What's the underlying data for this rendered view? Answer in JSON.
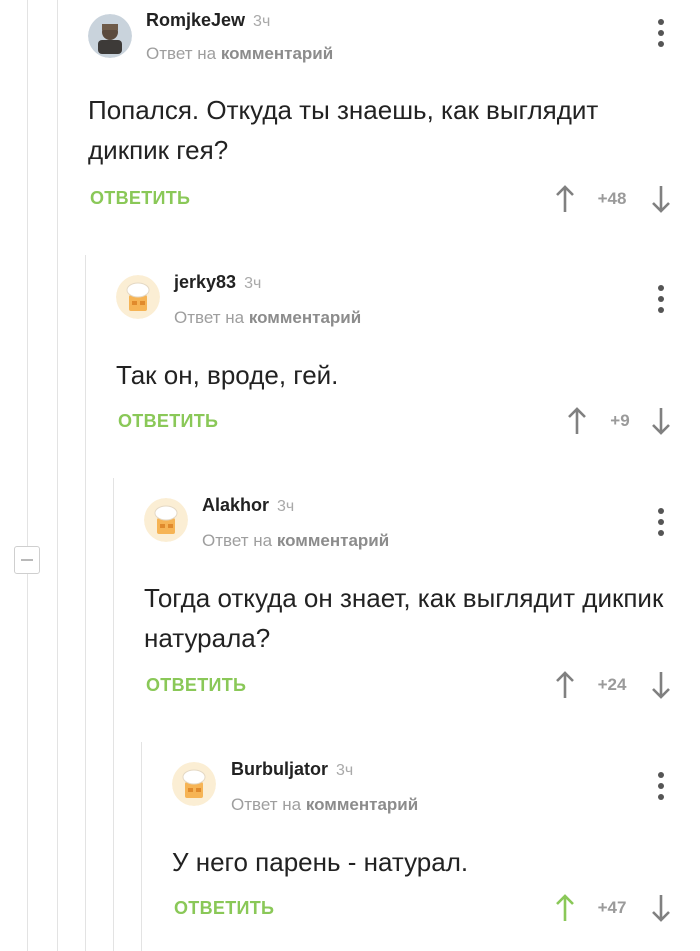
{
  "comments": [
    {
      "user": "RomjkeJew",
      "time": "3ч",
      "reply_prefix": "Ответ на",
      "reply_target": "комментарий",
      "text": "Попался. Откуда ты знаешь, как выглядит дикпик гея?",
      "reply_label": "ОТВЕТИТЬ",
      "score": "+48",
      "upvoted": false
    },
    {
      "user": "jerky83",
      "time": "3ч",
      "reply_prefix": "Ответ на",
      "reply_target": "комментарий",
      "text": "Так он, вроде, гей.",
      "reply_label": "ОТВЕТИТЬ",
      "score": "+9",
      "upvoted": false
    },
    {
      "user": "Alakhor",
      "time": "3ч",
      "reply_prefix": "Ответ на",
      "reply_target": "комментарий",
      "text": "Тогда откуда он знает, как выглядит дикпик натурала?",
      "reply_label": "ОТВЕТИТЬ",
      "score": "+24",
      "upvoted": false
    },
    {
      "user": "Burbuljator",
      "time": "3ч",
      "reply_prefix": "Ответ на",
      "reply_target": "комментарий",
      "text": "У него парень - натурал.",
      "reply_label": "ОТВЕТИТЬ",
      "score": "+47",
      "upvoted": true
    }
  ],
  "icons": {
    "collapse": "collapse-minus-icon",
    "menu": "kebab-menu-icon",
    "up": "arrow-up-icon",
    "down": "arrow-down-icon",
    "default_avatar": "chef-hat-avatar-icon"
  },
  "colors": {
    "accent": "#8ac858",
    "muted": "#9e9e9e",
    "thread_line": "#e3e3e3"
  }
}
